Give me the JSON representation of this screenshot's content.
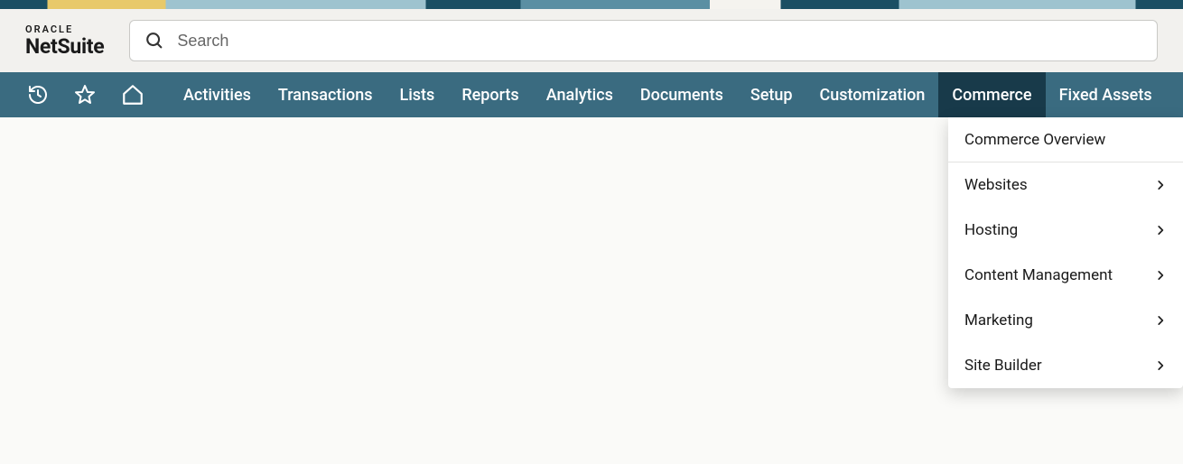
{
  "brand": {
    "top": "ORACLE",
    "bottom": "NetSuite"
  },
  "search": {
    "placeholder": "Search"
  },
  "nav": {
    "items": [
      {
        "label": "Activities"
      },
      {
        "label": "Transactions"
      },
      {
        "label": "Lists"
      },
      {
        "label": "Reports"
      },
      {
        "label": "Analytics"
      },
      {
        "label": "Documents"
      },
      {
        "label": "Setup"
      },
      {
        "label": "Customization"
      },
      {
        "label": "Commerce"
      },
      {
        "label": "Fixed Assets"
      }
    ],
    "active_index": 8
  },
  "dropdown": {
    "items": [
      {
        "label": "Commerce Overview",
        "has_submenu": false
      },
      {
        "label": "Websites",
        "has_submenu": true
      },
      {
        "label": "Hosting",
        "has_submenu": true
      },
      {
        "label": "Content Management",
        "has_submenu": true
      },
      {
        "label": "Marketing",
        "has_submenu": true
      },
      {
        "label": "Site Builder",
        "has_submenu": true
      }
    ]
  }
}
